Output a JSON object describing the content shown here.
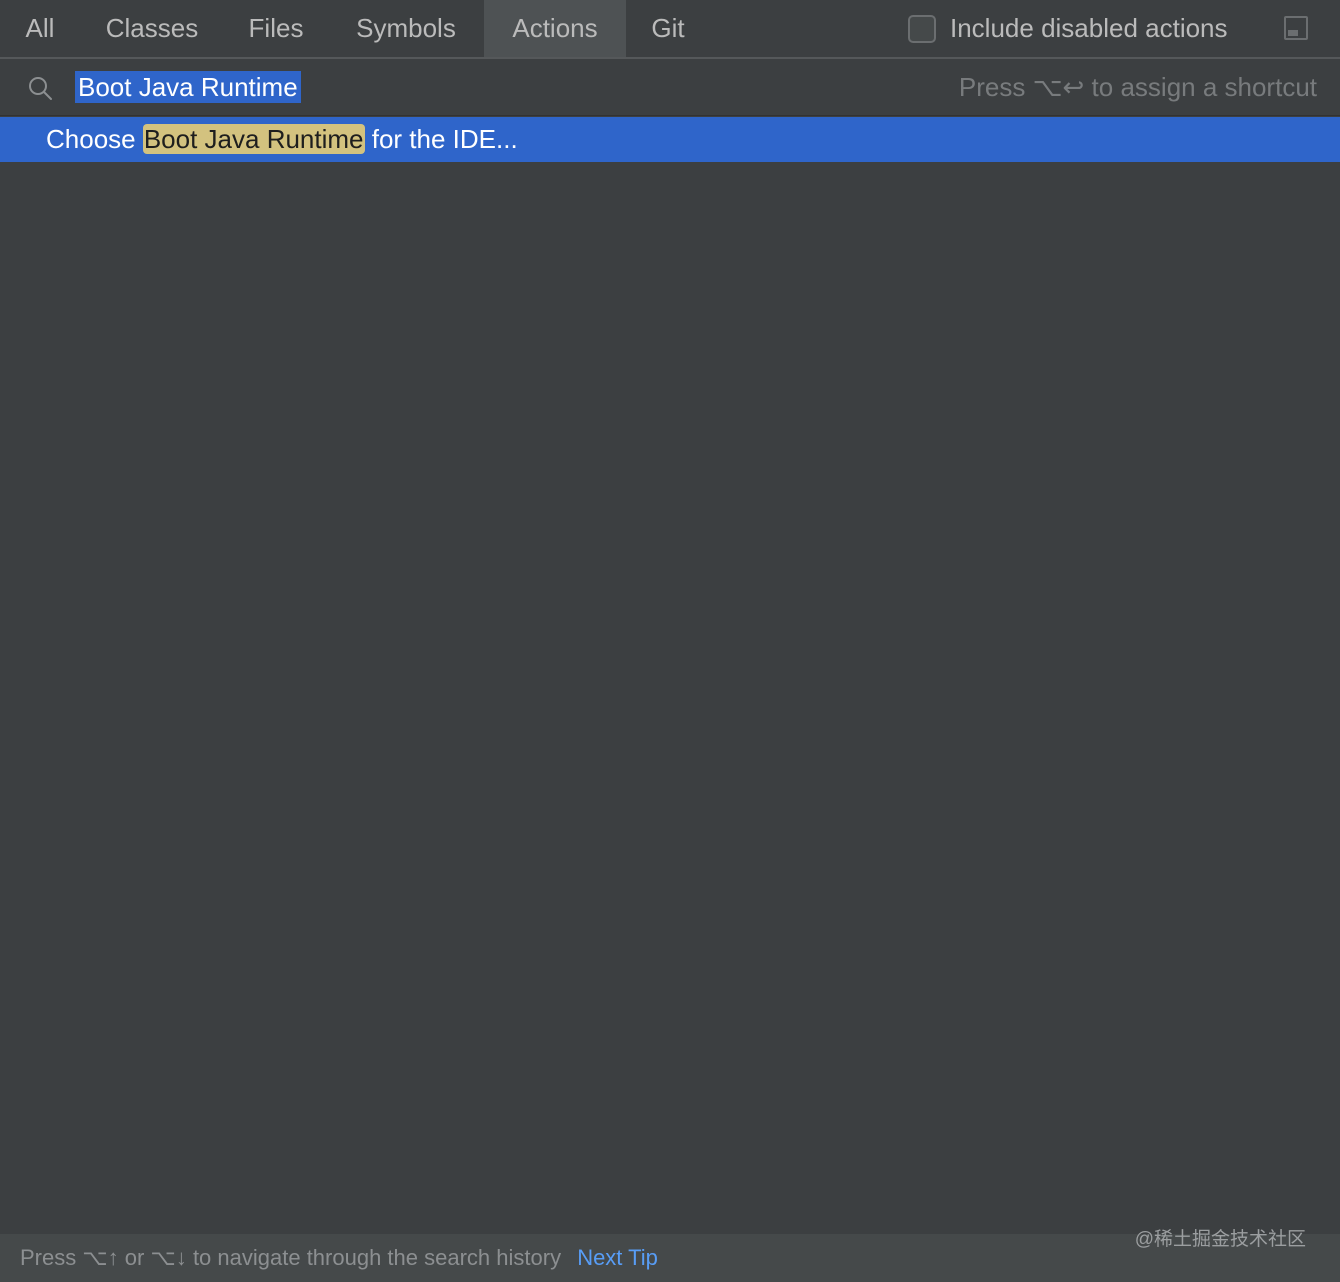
{
  "tabs": [
    {
      "label": "All",
      "active": false
    },
    {
      "label": "Classes",
      "active": false
    },
    {
      "label": "Files",
      "active": false
    },
    {
      "label": "Symbols",
      "active": false
    },
    {
      "label": "Actions",
      "active": true
    },
    {
      "label": "Git",
      "active": false
    }
  ],
  "options": {
    "include_disabled_label": "Include disabled actions",
    "include_disabled_checked": false,
    "preview_icon": "preview-panel-icon"
  },
  "search": {
    "icon": "search-icon",
    "value": "Boot Java Runtime",
    "hint": "Press ⌥↩ to assign a shortcut"
  },
  "results": [
    {
      "prefix": "Choose ",
      "match": "Boot Java Runtime",
      "suffix": " for the IDE...",
      "selected": true
    }
  ],
  "footer": {
    "hint": "Press ⌥↑ or ⌥↓ to navigate through the search history",
    "next_tip": "Next Tip"
  },
  "watermark": "@稀土掘金技术社区",
  "colors": {
    "background": "#3c3f41",
    "selection": "#2f65ca",
    "match_highlight": "#d3c27f",
    "link": "#589df6"
  }
}
